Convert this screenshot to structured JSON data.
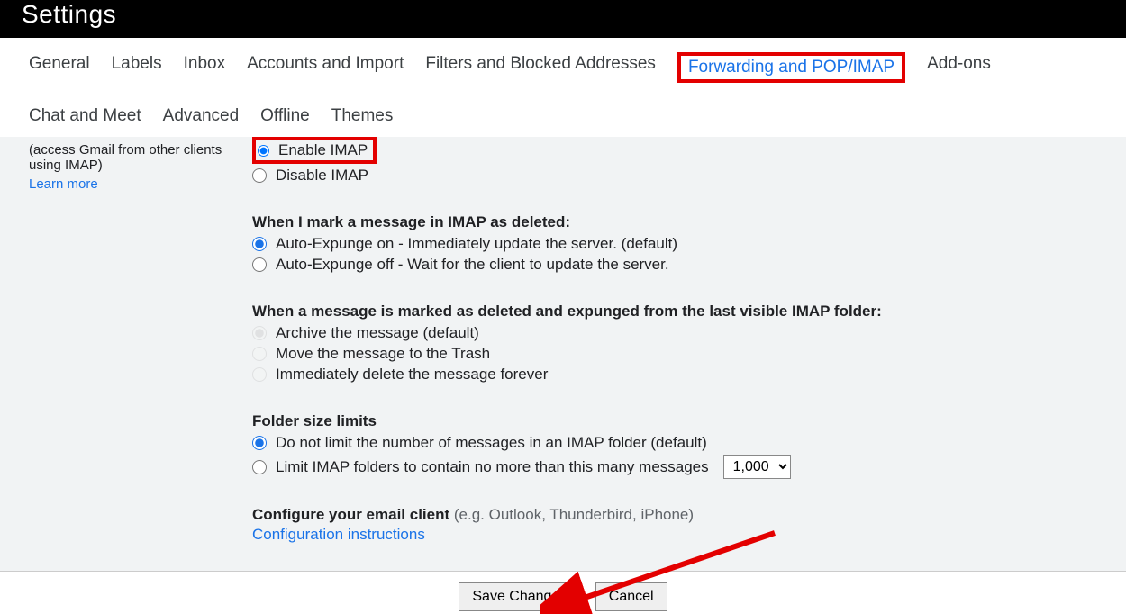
{
  "header": {
    "title": "Settings"
  },
  "tabs": [
    {
      "label": "General",
      "active": false
    },
    {
      "label": "Labels",
      "active": false
    },
    {
      "label": "Inbox",
      "active": false
    },
    {
      "label": "Accounts and Import",
      "active": false
    },
    {
      "label": "Filters and Blocked Addresses",
      "active": false
    },
    {
      "label": "Forwarding and POP/IMAP",
      "active": true
    },
    {
      "label": "Add-ons",
      "active": false
    },
    {
      "label": "Chat and Meet",
      "active": false
    },
    {
      "label": "Advanced",
      "active": false
    },
    {
      "label": "Offline",
      "active": false
    },
    {
      "label": "Themes",
      "active": false
    }
  ],
  "leftPanel": {
    "line1": "(access Gmail from other clients",
    "line2": "using IMAP)",
    "learnMore": "Learn more"
  },
  "imapAccess": {
    "enable": "Enable IMAP",
    "disable": "Disable IMAP"
  },
  "deletedSection": {
    "title": "When I mark a message in IMAP as deleted:",
    "opt1": "Auto-Expunge on - Immediately update the server. (default)",
    "opt2": "Auto-Expunge off - Wait for the client to update the server."
  },
  "expungedSection": {
    "title": "When a message is marked as deleted and expunged from the last visible IMAP folder:",
    "opt1": "Archive the message (default)",
    "opt2": "Move the message to the Trash",
    "opt3": "Immediately delete the message forever"
  },
  "folderLimits": {
    "title": "Folder size limits",
    "opt1": "Do not limit the number of messages in an IMAP folder (default)",
    "opt2": "Limit IMAP folders to contain no more than this many messages",
    "selectValue": "1,000"
  },
  "configure": {
    "bold": "Configure your email client",
    "grey": " (e.g. Outlook, Thunderbird, iPhone)",
    "link": "Configuration instructions"
  },
  "buttons": {
    "save": "Save Changes",
    "cancel": "Cancel"
  }
}
